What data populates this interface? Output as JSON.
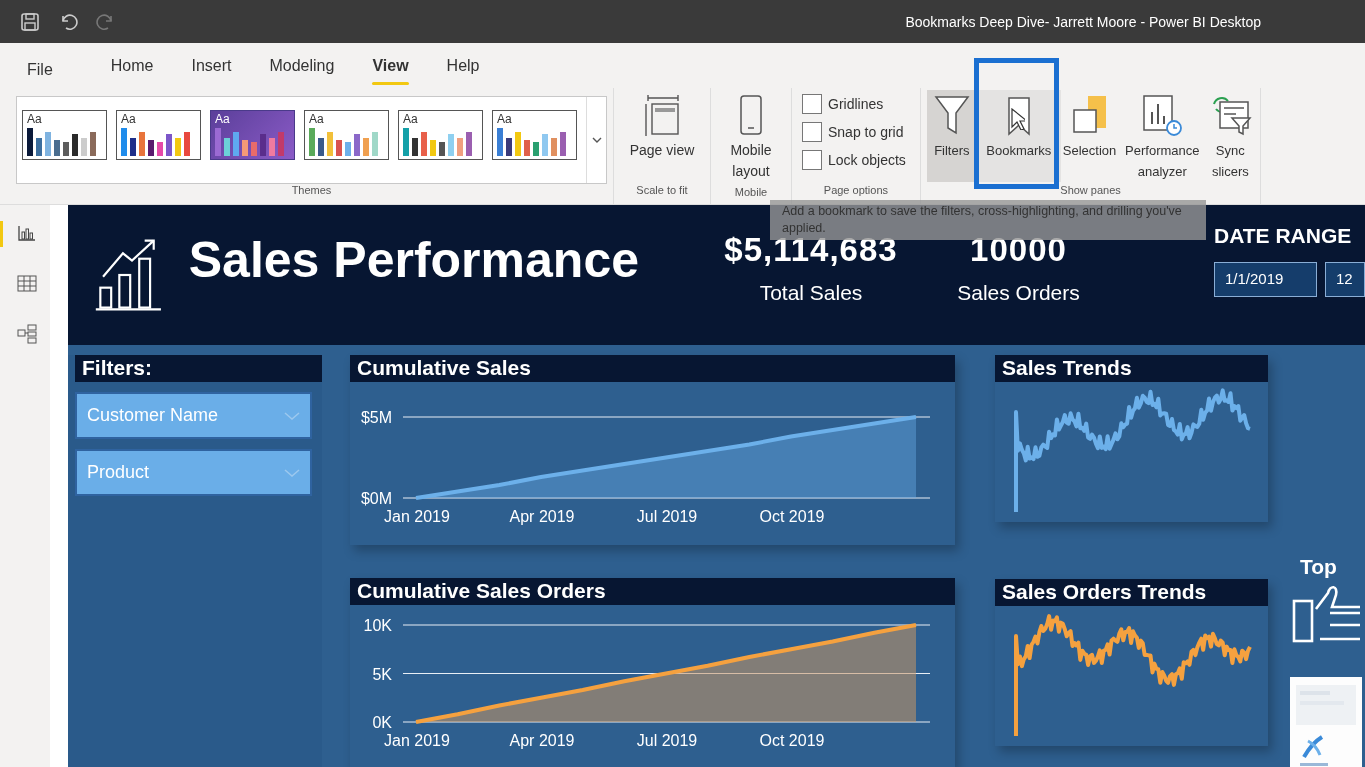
{
  "window": {
    "title": "Bookmarks Deep Dive- Jarrett Moore - Power BI Desktop"
  },
  "menu_tabs": [
    {
      "label": "File",
      "selected": false
    },
    {
      "label": "Home",
      "selected": false
    },
    {
      "label": "Insert",
      "selected": false
    },
    {
      "label": "Modeling",
      "selected": false
    },
    {
      "label": "View",
      "selected": true
    },
    {
      "label": "Help",
      "selected": false
    }
  ],
  "ribbon": {
    "themes": {
      "items": [
        {
          "label": "Aa",
          "selected": false
        },
        {
          "label": "Aa",
          "selected": false
        },
        {
          "label": "Aa",
          "selected": true
        },
        {
          "label": "Aa",
          "selected": false
        },
        {
          "label": "Aa",
          "selected": false
        },
        {
          "label": "Aa",
          "selected": false
        }
      ],
      "group_label": "Themes"
    },
    "scale_to_fit": {
      "button": "Page view",
      "group_label": "Scale to fit"
    },
    "mobile": {
      "button": "Mobile layout",
      "group_label": "Mobile"
    },
    "page_options": {
      "checkboxes": [
        {
          "label": "Gridlines",
          "checked": false
        },
        {
          "label": "Snap to grid",
          "checked": false
        },
        {
          "label": "Lock objects",
          "checked": false
        }
      ],
      "group_label": "Page options"
    },
    "show_panes": {
      "buttons": [
        {
          "label": "Filters",
          "kind": "filters",
          "on": true,
          "hovered": false
        },
        {
          "label": "Bookmarks",
          "kind": "bookmarks",
          "on": false,
          "hovered": true
        },
        {
          "label": "Selection",
          "kind": "selection",
          "on": false,
          "hovered": false
        },
        {
          "label": "Performance analyzer",
          "kind": "performance",
          "on": false,
          "hovered": false
        },
        {
          "label": "Sync slicers",
          "kind": "sync",
          "on": false,
          "hovered": false
        }
      ],
      "group_label": "Show panes"
    }
  },
  "tooltip": "Add a bookmark to save the filters, cross-highlighting, and drilling you've applied.",
  "nav": [
    {
      "kind": "report",
      "selected": true
    },
    {
      "kind": "data",
      "selected": false
    },
    {
      "kind": "model",
      "selected": false
    }
  ],
  "report": {
    "title": "Sales Performance",
    "kpis": [
      {
        "value": "$5,114,683",
        "label": "Total Sales"
      },
      {
        "value": "10000",
        "label": "Sales Orders"
      }
    ],
    "date_range": {
      "label": "DATE RANGE",
      "start": "1/1/2019",
      "end": "12"
    },
    "filters": {
      "title": "Filters:",
      "slicers": [
        "Customer Name",
        "Product"
      ]
    },
    "charts": [
      {
        "title": "Cumulative Sales",
        "chart_data": {
          "type": "area",
          "categories": [
            "Jan 2019",
            null,
            null,
            "Apr 2019",
            null,
            null,
            "Jul 2019",
            null,
            null,
            "Oct 2019",
            null,
            null,
            null
          ],
          "series": [
            {
              "color": "#6cb0ea",
              "values": [
                0,
                400000,
                800000,
                1300000,
                1700000,
                2100000,
                2500000,
                2900000,
                3300000,
                3800000,
                4200000,
                4600000,
                5000000
              ]
            }
          ],
          "ylim": [
            0,
            5000000
          ],
          "yticks": [
            {
              "value": 0,
              "label": "$0M"
            },
            {
              "value": 5000000,
              "label": "$5M"
            }
          ]
        }
      },
      {
        "title": "Cumulative Sales Orders",
        "chart_data": {
          "type": "area",
          "categories": [
            "Jan 2019",
            null,
            null,
            "Apr 2019",
            null,
            null,
            "Jul 2019",
            null,
            null,
            "Oct 2019",
            null,
            null,
            null
          ],
          "series": [
            {
              "color": "#f5a13f",
              "values": [
                0,
                800,
                1700,
                2500,
                3300,
                4200,
                5000,
                5800,
                6700,
                7500,
                8300,
                9200,
                10000
              ]
            }
          ],
          "ylim": [
            0,
            10000
          ],
          "yticks": [
            {
              "value": 0,
              "label": "0K"
            },
            {
              "value": 5000,
              "label": "5K"
            },
            {
              "value": 10000,
              "label": "10K"
            }
          ]
        }
      }
    ],
    "trends": [
      {
        "title": "Sales Trends",
        "color": "#6cb0ea"
      },
      {
        "title": "Sales Orders Trends",
        "color": "#f5a13f"
      }
    ],
    "top": {
      "label": "Top"
    }
  }
}
